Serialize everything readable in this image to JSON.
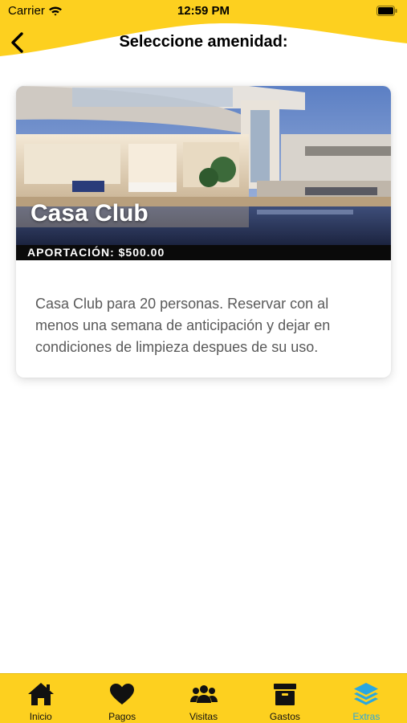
{
  "status_bar": {
    "carrier": "Carrier",
    "time": "12:59 PM"
  },
  "header": {
    "title": "Seleccione amenidad:",
    "back_icon": "chevron-left-icon"
  },
  "amenities": [
    {
      "name": "Casa Club",
      "price_label": "APORTACIÓN: $500.00",
      "description": "Casa Club para 20 personas. Reservar con al menos una semana de anticipación y dejar en condiciones de limpieza despues de su uso."
    }
  ],
  "tabbar": {
    "active": "Extras",
    "items": [
      {
        "label": "Inicio",
        "icon": "home-icon"
      },
      {
        "label": "Pagos",
        "icon": "heart-icon"
      },
      {
        "label": "Visitas",
        "icon": "users-icon"
      },
      {
        "label": "Gastos",
        "icon": "archive-box-icon"
      },
      {
        "label": "Extras",
        "icon": "layers-icon"
      }
    ]
  },
  "colors": {
    "brand_yellow": "#fdd01f",
    "active_tab": "#2aa7e0",
    "price_bar": "#0a0a0a"
  }
}
